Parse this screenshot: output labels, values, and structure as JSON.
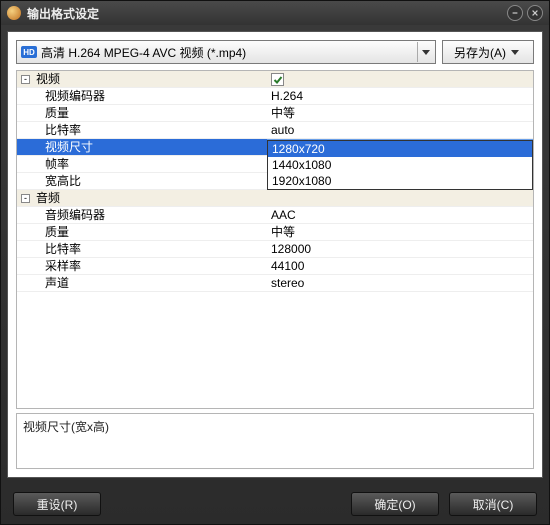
{
  "window": {
    "title": "输出格式设定"
  },
  "format": {
    "badge": "HD",
    "label": "高清 H.264 MPEG-4 AVC 视频 (*.mp4)"
  },
  "saveas": {
    "label": "另存为(A)"
  },
  "groups": {
    "video": "视频",
    "audio": "音频"
  },
  "video": {
    "encoder": {
      "k": "视频编码器",
      "v": "H.264"
    },
    "quality": {
      "k": "质量",
      "v": "中等"
    },
    "bitrate": {
      "k": "比特率",
      "v": "auto"
    },
    "size": {
      "k": "视频尺寸",
      "v": "1280x720"
    },
    "fps": {
      "k": "帧率",
      "v": ""
    },
    "aspect": {
      "k": "宽高比",
      "v": ""
    }
  },
  "size_options": [
    "1280x720",
    "1440x1080",
    "1920x1080"
  ],
  "audio": {
    "encoder": {
      "k": "音频编码器",
      "v": "AAC"
    },
    "quality": {
      "k": "质量",
      "v": "中等"
    },
    "bitrate": {
      "k": "比特率",
      "v": "128000"
    },
    "samplerate": {
      "k": "采样率",
      "v": "44100"
    },
    "channels": {
      "k": "声道",
      "v": "stereo"
    }
  },
  "description": "视频尺寸(宽x高)",
  "buttons": {
    "reset": "重设(R)",
    "ok": "确定(O)",
    "cancel": "取消(C)"
  }
}
